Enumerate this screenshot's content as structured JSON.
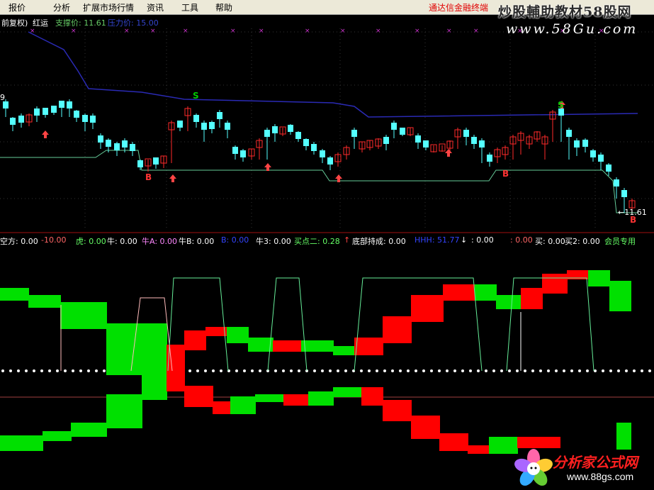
{
  "menubar": {
    "items": [
      "报价",
      "分析",
      "扩展市场行情",
      "资讯",
      "工具",
      "帮助"
    ],
    "ad_text": "通达信金融终端"
  },
  "watermark": {
    "title": "炒股輔助教材58股网",
    "url": "www.58Gu.com"
  },
  "price_panel": {
    "label_mode": "前复权)",
    "label_name": "红运",
    "support_label": "支撑价: 11.61",
    "pressure_label": "压力价: 15.00",
    "left_edge_value": "9",
    "last_price_label": "←11.61",
    "signal_sell_top": "S",
    "signal_sell_top_2": "S",
    "signal_b_1": "B",
    "signal_b_2": "B",
    "signal_b_3": "B",
    "colors": {
      "up_candle": "#ff2a2a",
      "down_candle": "#54ffff",
      "support_line": "#66cc99",
      "pressure_line": "#2a2ab4",
      "signal_cross": "#cc33cc",
      "arrow": "#ff4444",
      "signal_s": "#00cc00"
    }
  },
  "indicator_bar": {
    "items": [
      {
        "text": "空方: 0.00",
        "color": "#ffffff"
      },
      {
        "text": "-10.00",
        "color": "#ff6666"
      },
      {
        "text": "虎: 0.00",
        "color": "#66ff66"
      },
      {
        "text": "牛: 0.00",
        "color": "#ffffff"
      },
      {
        "text": "牛A: 0.00",
        "color": "#ff88ff"
      },
      {
        "text": "牛B: 0.00",
        "color": "#ffffff"
      },
      {
        "text": "B: 0.00",
        "color": "#3344ff"
      },
      {
        "text": "牛3: 0.00",
        "color": "#ffffff"
      },
      {
        "text": "买点二: 0.28",
        "color": "#66ff66"
      },
      {
        "text": "↑",
        "color": "#ff4444"
      },
      {
        "text": "底部持成: 0.00",
        "color": "#ffffff"
      },
      {
        "text": "HHH: 51.77",
        "color": "#3344ff"
      },
      {
        "text": "↓",
        "color": "#ffffff"
      },
      {
        "text": ": 0.00",
        "color": "#ffffff"
      },
      {
        "text": ": 0.00",
        "color": "#ff6666"
      },
      {
        "text": "买: 0.00",
        "color": "#ffffff"
      },
      {
        "text": "买2: 0.00",
        "color": "#ffffff"
      },
      {
        "text": "会员专用",
        "color": "#66ff66"
      }
    ]
  },
  "logo": {
    "text": "分析家公式网",
    "url": "www.88gs.com"
  }
}
